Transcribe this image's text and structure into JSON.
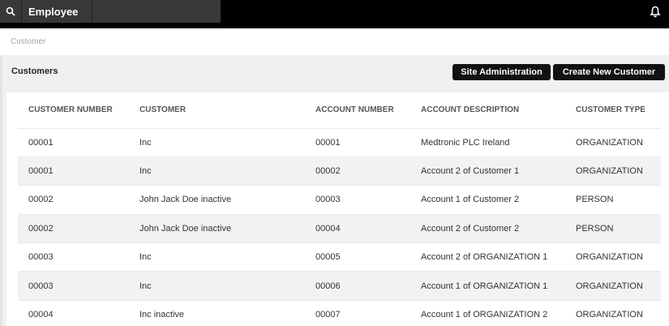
{
  "header": {
    "search_value": "Employee",
    "search_icon": "search-icon",
    "notification_icon": "bell-icon"
  },
  "breadcrumb": "Customer",
  "panel": {
    "title": "Customers",
    "site_admin_label": "Site Administration",
    "create_customer_label": "Create New Customer"
  },
  "table": {
    "columns": [
      "CUSTOMER NUMBER",
      "CUSTOMER",
      "ACCOUNT NUMBER",
      "ACCOUNT DESCRIPTION",
      "CUSTOMER TYPE"
    ],
    "rows": [
      [
        "00001",
        "Inc",
        "00001",
        "Medtronic PLC Ireland",
        "ORGANIZATION"
      ],
      [
        "00001",
        "Inc",
        "00002",
        "Account 2 of Customer 1",
        "ORGANIZATION"
      ],
      [
        "00002",
        "John Jack Doe inactive",
        "00003",
        "Account 1 of Customer 2",
        "PERSON"
      ],
      [
        "00002",
        "John Jack Doe inactive",
        "00004",
        "Account 2 of Customer 2",
        "PERSON"
      ],
      [
        "00003",
        "Inc",
        "00005",
        "Account 2 of ORGANIZATION 1",
        "ORGANIZATION"
      ],
      [
        "00003",
        "Inc",
        "00006",
        "Account 1 of ORGANIZATION 1",
        "ORGANIZATION"
      ],
      [
        "00004",
        "Inc inactive",
        "00007",
        "Account 1 of ORGANIZATION 2",
        "ORGANIZATION"
      ]
    ]
  }
}
